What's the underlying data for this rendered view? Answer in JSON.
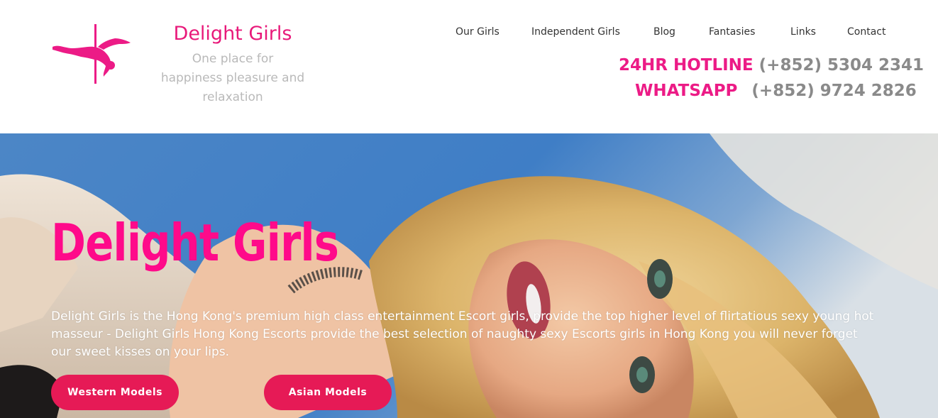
{
  "brand": {
    "title": "Delight Girls",
    "tagline_lines": [
      "One place for",
      "happiness pleasure and",
      "relaxation"
    ],
    "logo_icon": "pole-dancer-icon",
    "accent_color": "#e8197a"
  },
  "nav": {
    "items": [
      "Our Girls",
      "Independent Girls",
      "Blog",
      "Fantasies",
      "Links",
      "Contact"
    ]
  },
  "contact": {
    "hotline_label": "24HR HOTLINE",
    "hotline_number": "(+852) 5304 2341",
    "whatsapp_label": "WHATSAPP",
    "whatsapp_number": "(+852) 9724 2826",
    "label_color": "#ec1b86",
    "number_color": "#8a8a8a"
  },
  "hero": {
    "title": "Delight Girls",
    "description": "Delight Girls is the Hong Kong's premium high class entertainment Escort girls, provide the top higher level of flirtatious sexy young hot masseur - Delight Girls Hong Kong Escorts provide the best selection of naughty sexy Escorts girls in Hong Kong you will never forget our sweet kisses on your lips.",
    "title_color": "#ff0a8a",
    "buttons": [
      "Western Models",
      "Asian Models"
    ],
    "button_color": "#e61a56"
  }
}
